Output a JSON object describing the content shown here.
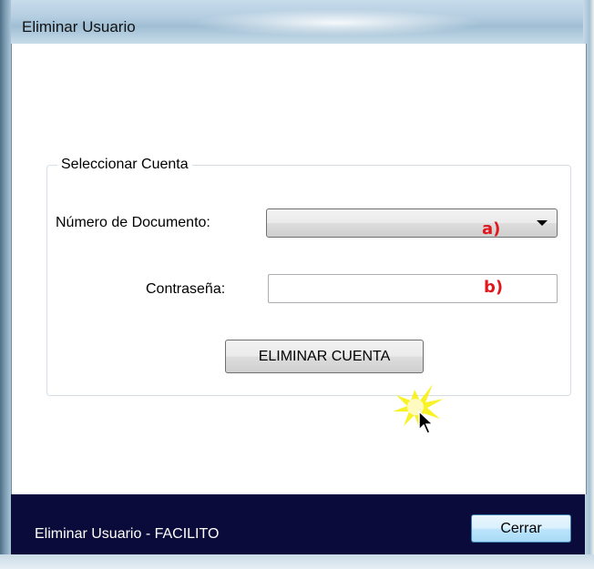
{
  "window": {
    "title": "Eliminar Usuario"
  },
  "group": {
    "legend": "Seleccionar Cuenta",
    "document_label": "Número de Documento:",
    "document_value": "",
    "marker_a": "a)",
    "password_label": "Contraseña:",
    "password_value": "",
    "marker_b": "b)",
    "delete_button": "ELIMINAR CUENTA"
  },
  "footer": {
    "status_text": "Eliminar Usuario - FACILITO",
    "close_button": "Cerrar"
  },
  "colors": {
    "footer_bg": "#0b0b3b",
    "marker": "#e0171d"
  }
}
